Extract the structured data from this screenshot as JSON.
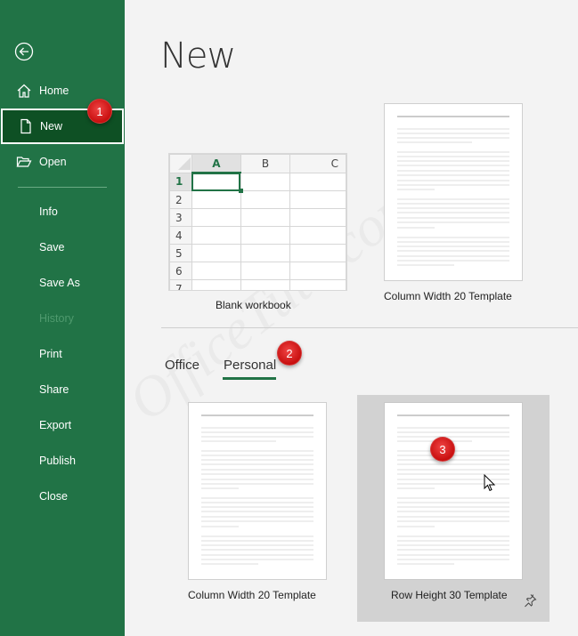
{
  "sidebar": {
    "back_icon": "back-arrow-circle-icon",
    "items": [
      {
        "label": "Home",
        "icon": "home-icon",
        "state": "normal"
      },
      {
        "label": "New",
        "icon": "new-document-icon",
        "state": "active"
      },
      {
        "label": "Open",
        "icon": "open-folder-icon",
        "state": "normal"
      },
      {
        "label": "Info",
        "state": "normal"
      },
      {
        "label": "Save",
        "state": "normal"
      },
      {
        "label": "Save As",
        "state": "normal"
      },
      {
        "label": "History",
        "state": "disabled"
      },
      {
        "label": "Print",
        "state": "normal"
      },
      {
        "label": "Share",
        "state": "normal"
      },
      {
        "label": "Export",
        "state": "normal"
      },
      {
        "label": "Publish",
        "state": "normal"
      },
      {
        "label": "Close",
        "state": "normal"
      }
    ]
  },
  "main": {
    "title": "New",
    "featured": [
      {
        "label": "Blank workbook",
        "grid": {
          "columns": [
            "A",
            "B",
            "C"
          ],
          "rows": [
            "1",
            "2",
            "3",
            "4",
            "5",
            "6",
            "7"
          ],
          "selected_cell": "A1"
        }
      },
      {
        "label": "Column Width 20 Template"
      }
    ],
    "tabs": [
      {
        "label": "Office",
        "selected": false
      },
      {
        "label": "Personal",
        "selected": true
      }
    ],
    "personal_templates": [
      {
        "label": "Column Width 20 Template",
        "hovered": false
      },
      {
        "label": "Row Height 30 Template",
        "hovered": true,
        "pin_icon": "pin-icon"
      }
    ]
  },
  "annotations": {
    "badges": [
      "1",
      "2",
      "3"
    ]
  },
  "watermark": "OfficeTuto.com",
  "colors": {
    "accent": "#217346",
    "active_item": "#0e5024",
    "badge": "#d91a1a",
    "background": "#f3f3f3"
  }
}
